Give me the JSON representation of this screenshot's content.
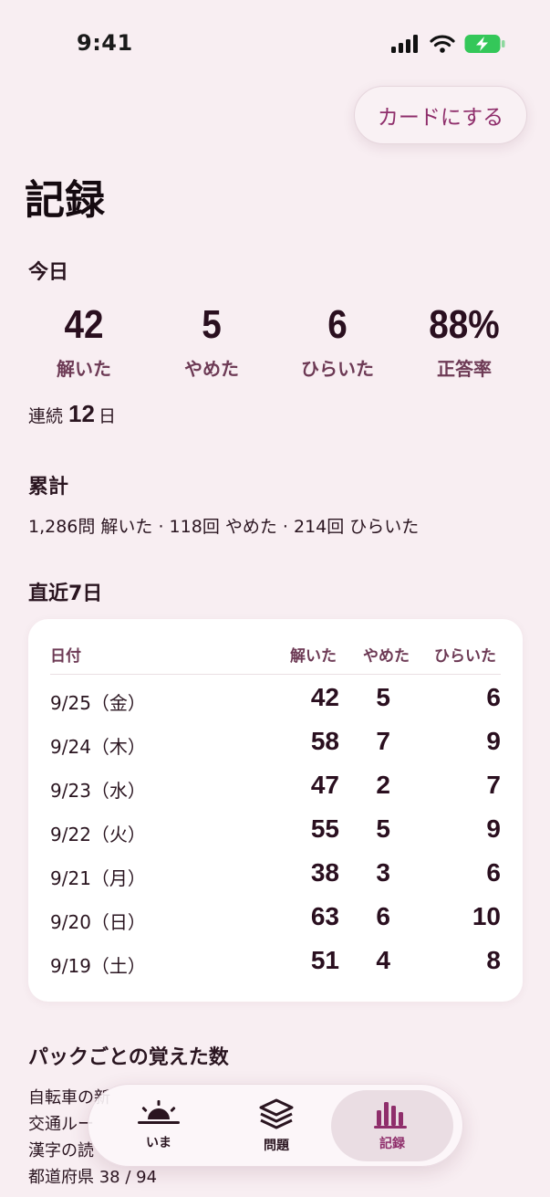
{
  "status_bar": {
    "time": "9:41"
  },
  "header": {
    "card_button": "カードにする",
    "title": "記録"
  },
  "today": {
    "section_title": "今日",
    "stats": [
      {
        "value": "42",
        "label": "解いた"
      },
      {
        "value": "5",
        "label": "やめた"
      },
      {
        "value": "6",
        "label": "ひらいた"
      },
      {
        "value": "88%",
        "label": "正答率"
      }
    ],
    "streak": {
      "prefix": "連続",
      "value": "12",
      "suffix": "日"
    }
  },
  "cumulative": {
    "section_title": "累計",
    "text": "1,286問 解いた · 118回 やめた · 214回 ひらいた"
  },
  "recent": {
    "section_title": "直近7日",
    "headers": {
      "date": "日付",
      "solved": "解いた",
      "quit": "やめた",
      "opened": "ひらいた"
    },
    "rows": [
      {
        "date": "9/25（金）",
        "solved": "42",
        "quit": "5",
        "opened": "6"
      },
      {
        "date": "9/24（木）",
        "solved": "58",
        "quit": "7",
        "opened": "9"
      },
      {
        "date": "9/23（水）",
        "solved": "47",
        "quit": "2",
        "opened": "7"
      },
      {
        "date": "9/22（火）",
        "solved": "55",
        "quit": "5",
        "opened": "9"
      },
      {
        "date": "9/21（月）",
        "solved": "38",
        "quit": "3",
        "opened": "6"
      },
      {
        "date": "9/20（日）",
        "solved": "63",
        "quit": "6",
        "opened": "10"
      },
      {
        "date": "9/19（土）",
        "solved": "51",
        "quit": "4",
        "opened": "8"
      }
    ]
  },
  "packs": {
    "section_title": "パックごとの覚えた数",
    "items": [
      "自転車の新",
      "交通ルー",
      "漢字の読",
      "都道府県 38 / 94"
    ]
  },
  "tabbar": {
    "tabs": [
      {
        "label": "いま",
        "icon": "sunrise-icon"
      },
      {
        "label": "問題",
        "icon": "stack-icon"
      },
      {
        "label": "記録",
        "icon": "bar-chart-icon"
      }
    ],
    "active_index": 2
  },
  "colors": {
    "accent": "#8f2e6b",
    "background": "#f8eef2",
    "battery": "#34c759"
  }
}
